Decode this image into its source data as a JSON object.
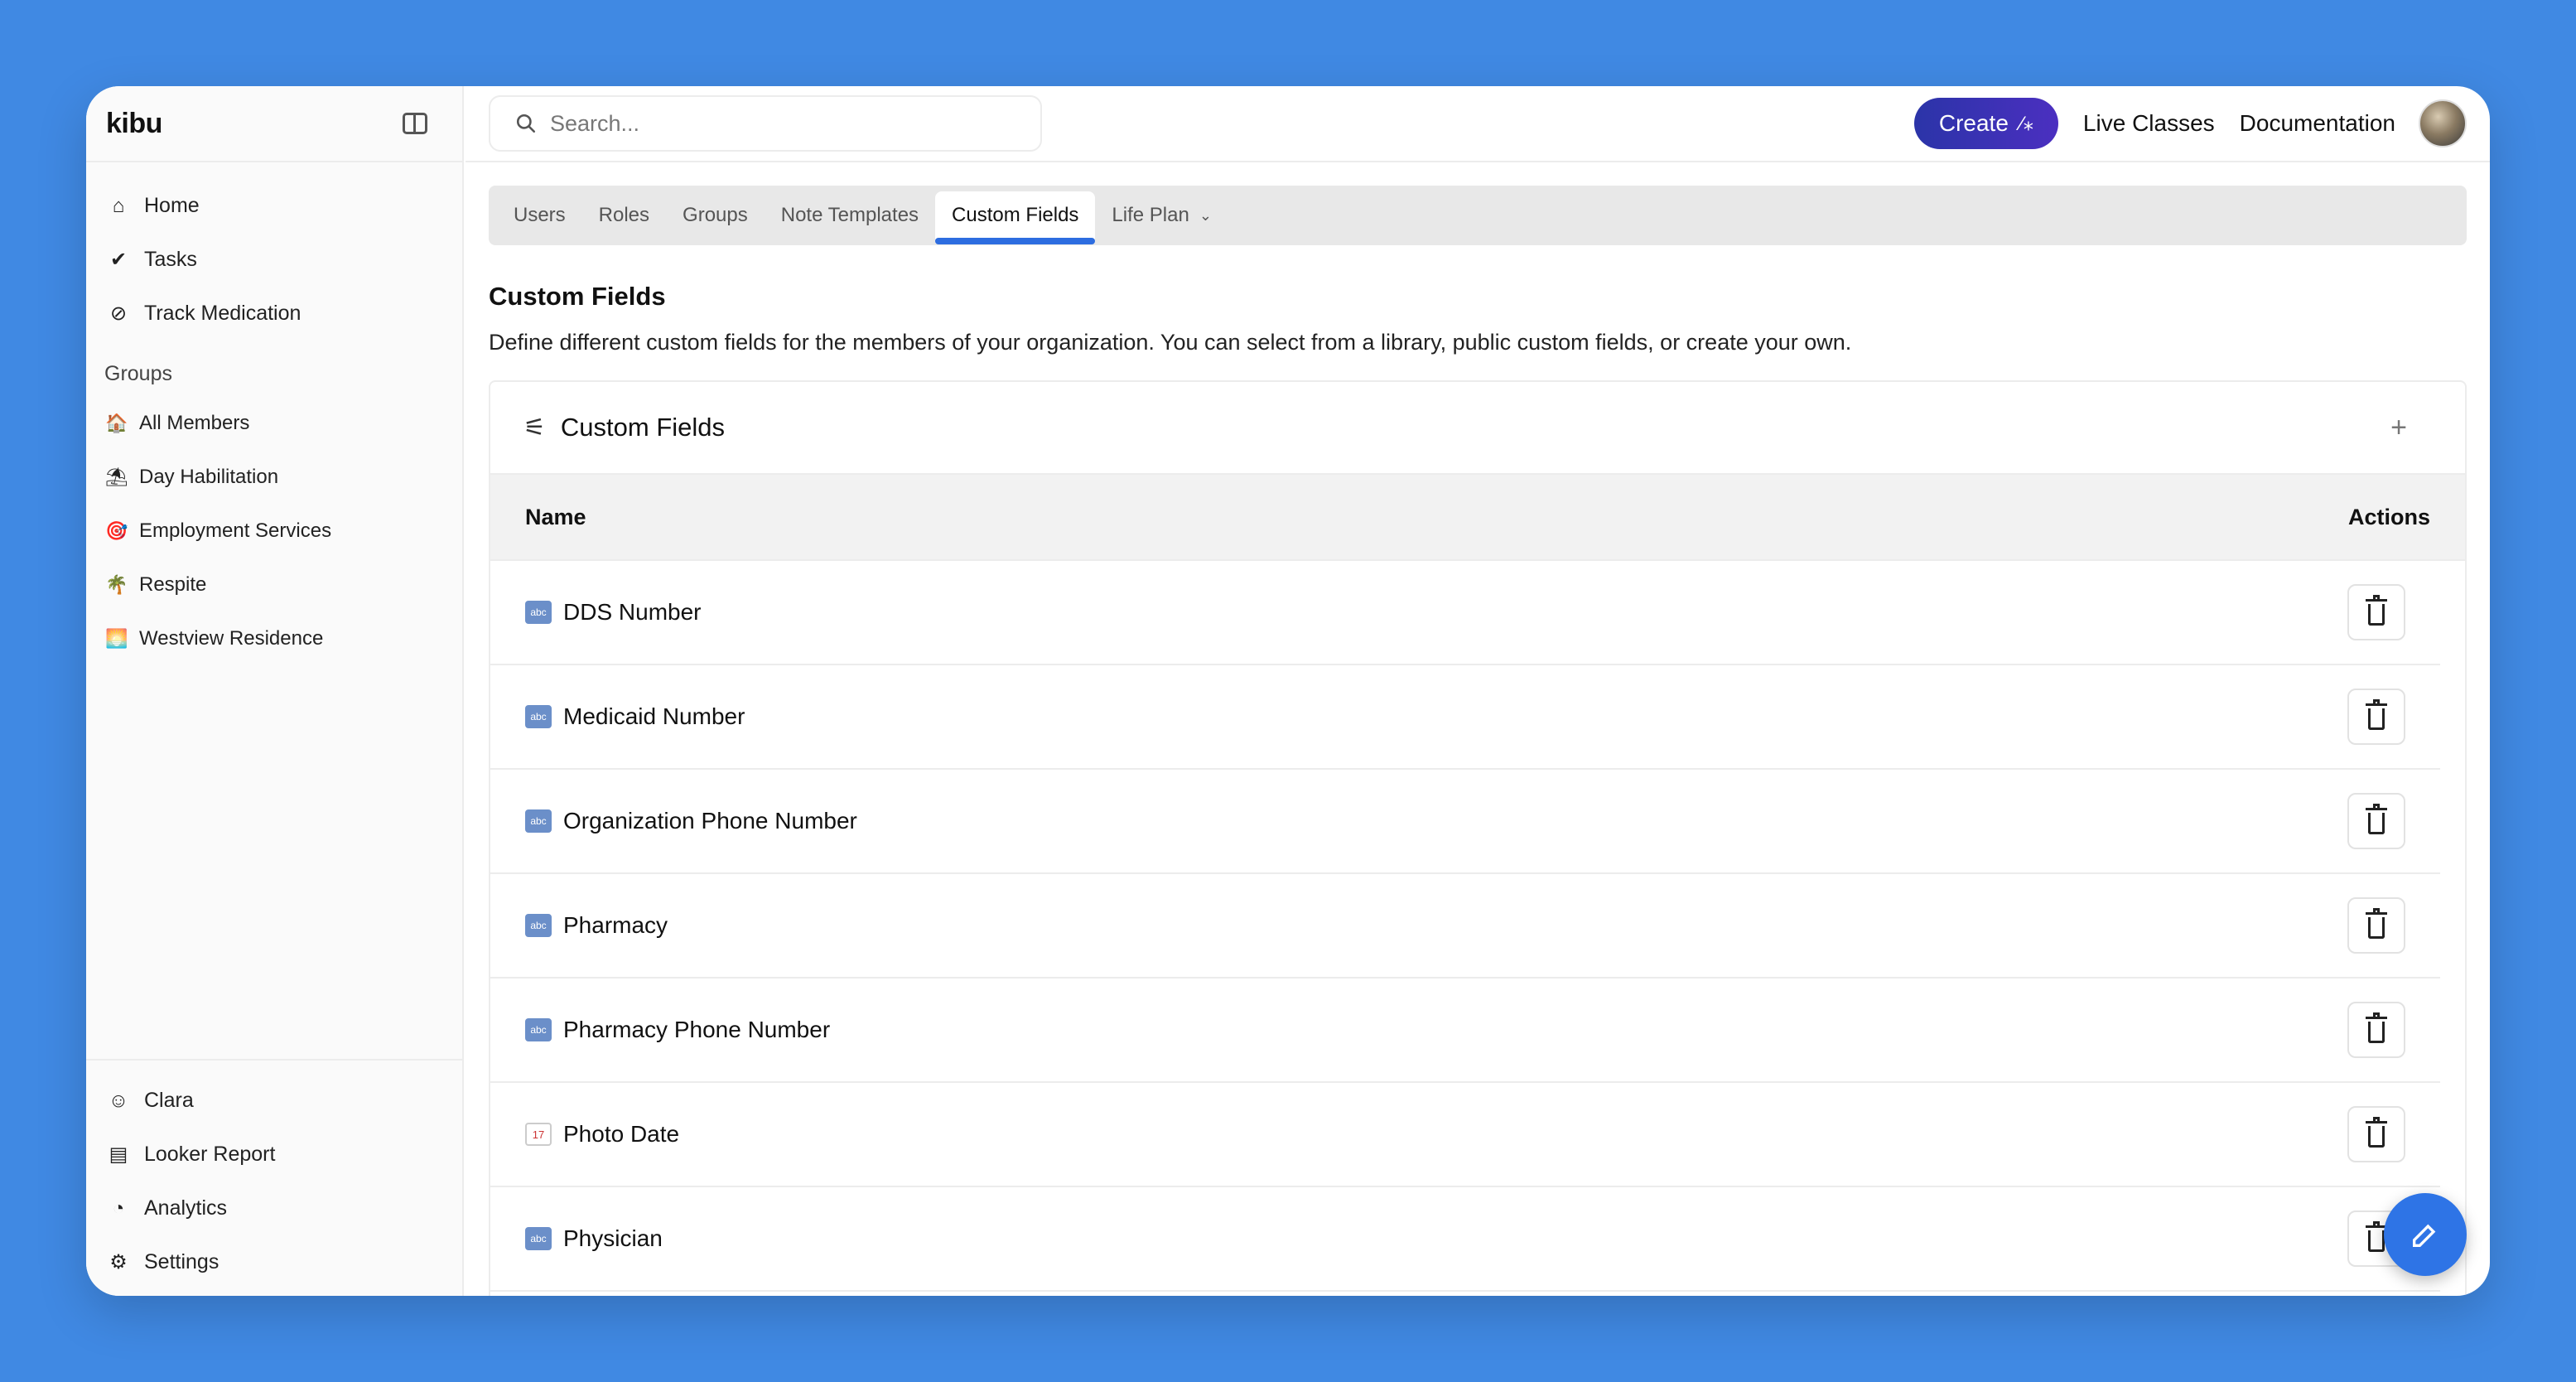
{
  "app": {
    "logo": "kibu"
  },
  "sidebar": {
    "nav": [
      {
        "label": "Home",
        "icon": "home-icon"
      },
      {
        "label": "Tasks",
        "icon": "tasks-icon"
      },
      {
        "label": "Track Medication",
        "icon": "pill-icon"
      }
    ],
    "groups_title": "Groups",
    "groups": [
      {
        "label": "All Members",
        "emoji": "🏠"
      },
      {
        "label": "Day Habilitation",
        "emoji": "⛱"
      },
      {
        "label": "Employment Services",
        "emoji": "🎯"
      },
      {
        "label": "Respite",
        "emoji": "🌴"
      },
      {
        "label": "Westview Residence",
        "emoji": "🌅"
      }
    ],
    "bottom": [
      {
        "label": "Clara",
        "icon": "clara-avatar-icon"
      },
      {
        "label": "Looker Report",
        "icon": "document-icon"
      },
      {
        "label": "Analytics",
        "icon": "pie-chart-icon"
      },
      {
        "label": "Settings",
        "icon": "gear-icon"
      }
    ]
  },
  "topbar": {
    "search_placeholder": "Search...",
    "create_label": "Create",
    "links": [
      "Live Classes",
      "Documentation"
    ]
  },
  "tabs": [
    {
      "label": "Users",
      "active": false
    },
    {
      "label": "Roles",
      "active": false
    },
    {
      "label": "Groups",
      "active": false
    },
    {
      "label": "Note Templates",
      "active": false
    },
    {
      "label": "Custom Fields",
      "active": true
    },
    {
      "label": "Life Plan",
      "active": false
    }
  ],
  "page": {
    "title": "Custom Fields",
    "description": "Define different custom fields for the members of your organization. You can select from a library, public custom fields, or create your own."
  },
  "card": {
    "title": "Custom Fields",
    "columns": {
      "name": "Name",
      "actions": "Actions"
    },
    "rows": [
      {
        "name": "DDS Number",
        "type": "abc"
      },
      {
        "name": "Medicaid Number",
        "type": "abc"
      },
      {
        "name": "Organization Phone Number",
        "type": "abc"
      },
      {
        "name": "Pharmacy",
        "type": "abc"
      },
      {
        "name": "Pharmacy Phone Number",
        "type": "abc"
      },
      {
        "name": "Photo Date",
        "type": "17"
      },
      {
        "name": "Physician",
        "type": "abc"
      }
    ]
  },
  "colors": {
    "background": "#4089e3",
    "accent": "#2d6de0",
    "create": "#2b34a8"
  }
}
